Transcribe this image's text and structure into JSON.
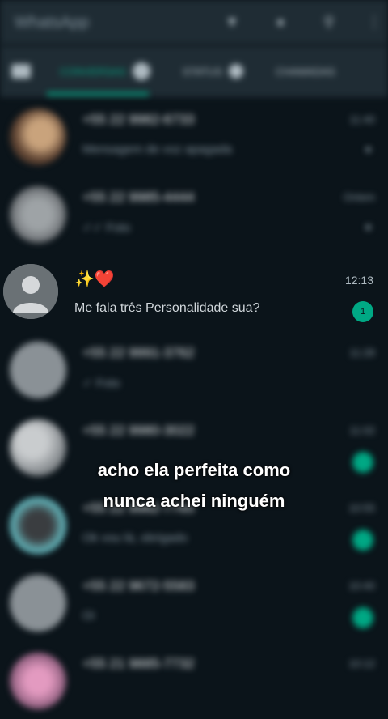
{
  "header": {
    "title": "WhatsApp",
    "icons": [
      "camera-icon",
      "wifi-icon",
      "search-icon",
      "more-icon"
    ]
  },
  "tabs": [
    {
      "label": "CONVERSAS",
      "active": true
    },
    {
      "label": "STATUS",
      "active": false
    },
    {
      "label": "CHAMADAS",
      "active": false
    }
  ],
  "chats": [
    {
      "name": "+55 22 9982-6733",
      "message": "Mensagem de voz apagada",
      "time": "11:40",
      "pinned": true
    },
    {
      "name": "+55 22 9985-4444",
      "message": "✓✓ Foto",
      "time": "Ontem",
      "pinned": true
    },
    {
      "name": "+55 22 9991-3762",
      "message": "✓ Foto",
      "time": "11:28"
    },
    {
      "name": "+55 22 9980-3022",
      "message": "",
      "time": "11:02"
    },
    {
      "name": "+55 22 9982-7765",
      "message": "Ok vou lá, obrigado",
      "time": "10:55"
    },
    {
      "name": "+55 22 9672-5583",
      "message": "Oi",
      "time": "10:40"
    },
    {
      "name": "+55 21 9885-7732",
      "message": "",
      "time": "10:12"
    }
  ],
  "focused_chat": {
    "name": "✨❤️",
    "time": "12:13",
    "message": "Me fala três Personalidade sua?",
    "unread": "1"
  },
  "caption": {
    "line1": "acho ela perfeita como",
    "line2": "nunca achei ninguém"
  },
  "colors": {
    "accent": "#00a884",
    "background": "#0b141a",
    "header": "#1f2c34"
  }
}
